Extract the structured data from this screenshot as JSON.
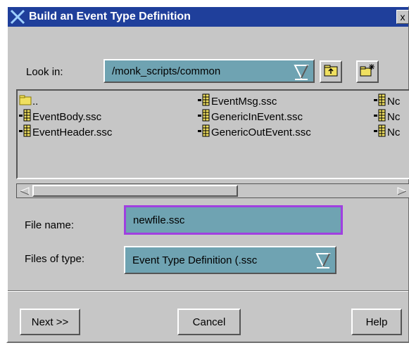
{
  "window": {
    "title": "Build an Event Type Definition",
    "close_label": "x"
  },
  "look_in": {
    "label": "Look in:",
    "value": "/monk_scripts/common"
  },
  "files": [
    {
      "name": ".."
    },
    {
      "name": "EventBody.ssc"
    },
    {
      "name": "EventHeader.ssc"
    },
    {
      "name": "EventMsg.ssc"
    },
    {
      "name": "GenericInEvent.ssc"
    },
    {
      "name": "GenericOutEvent.ssc"
    },
    {
      "name": "Nc"
    },
    {
      "name": "Nc"
    },
    {
      "name": "Nc"
    }
  ],
  "file_name": {
    "label": "File name:",
    "value": "newfile.ssc"
  },
  "files_of_type": {
    "label": "Files of type:",
    "value": "Event Type Definition (.ssc"
  },
  "buttons": {
    "next": "Next >>",
    "cancel": "Cancel",
    "help": "Help"
  },
  "icons": {
    "app": "x-logo-icon",
    "up_folder": "up-folder-icon",
    "new_folder": "new-folder-icon",
    "folder": "folder-icon",
    "file": "ssc-file-icon"
  }
}
